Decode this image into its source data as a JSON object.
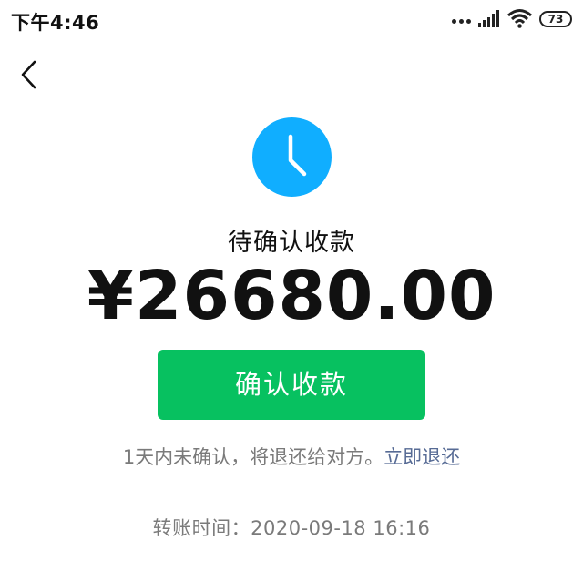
{
  "status_bar": {
    "time": "下午4:46",
    "battery_level": "73",
    "icons": [
      "signal-dots-icon",
      "signal-icon",
      "wifi-icon",
      "battery-icon"
    ]
  },
  "nav": {
    "back_icon": "chevron-left-icon"
  },
  "transfer": {
    "status_icon": "clock-icon",
    "status_title": "待确认收款",
    "amount": "¥26680.00",
    "confirm_label": "确认收款",
    "notice": "1天内未确认，将退还给对方。",
    "refund_link": "立即退还",
    "time_label": "转账时间：",
    "time_value": "2020-09-18 16:16"
  },
  "colors": {
    "accent": "#07c160",
    "clock": "#10aeff",
    "link": "#576b95",
    "muted_text": "#7a7a7a"
  }
}
